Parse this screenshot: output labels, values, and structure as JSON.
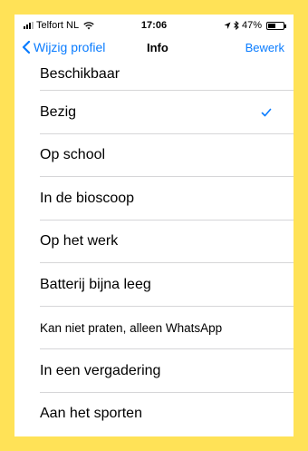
{
  "status_bar": {
    "carrier": "Telfort NL",
    "time": "17:06",
    "battery_percent": "47%",
    "battery_level": 0.47,
    "icons": [
      "signal-icon",
      "wifi-icon",
      "location-icon",
      "bluetooth-icon",
      "battery-icon"
    ]
  },
  "nav": {
    "back_label": "Wijzig profiel",
    "title": "Info",
    "edit_label": "Bewerk"
  },
  "status_options": [
    {
      "label": "Beschikbaar",
      "selected": false
    },
    {
      "label": "Bezig",
      "selected": true
    },
    {
      "label": "Op school",
      "selected": false
    },
    {
      "label": "In de bioscoop",
      "selected": false
    },
    {
      "label": "Op het werk",
      "selected": false
    },
    {
      "label": "Batterij bijna leeg",
      "selected": false
    },
    {
      "label": "Kan niet praten, alleen WhatsApp",
      "selected": false
    },
    {
      "label": "In een vergadering",
      "selected": false
    },
    {
      "label": "Aan het sporten",
      "selected": false
    }
  ],
  "colors": {
    "background_frame": "#ffe257",
    "accent": "#0a7cff",
    "separator": "#d6d6d8"
  }
}
